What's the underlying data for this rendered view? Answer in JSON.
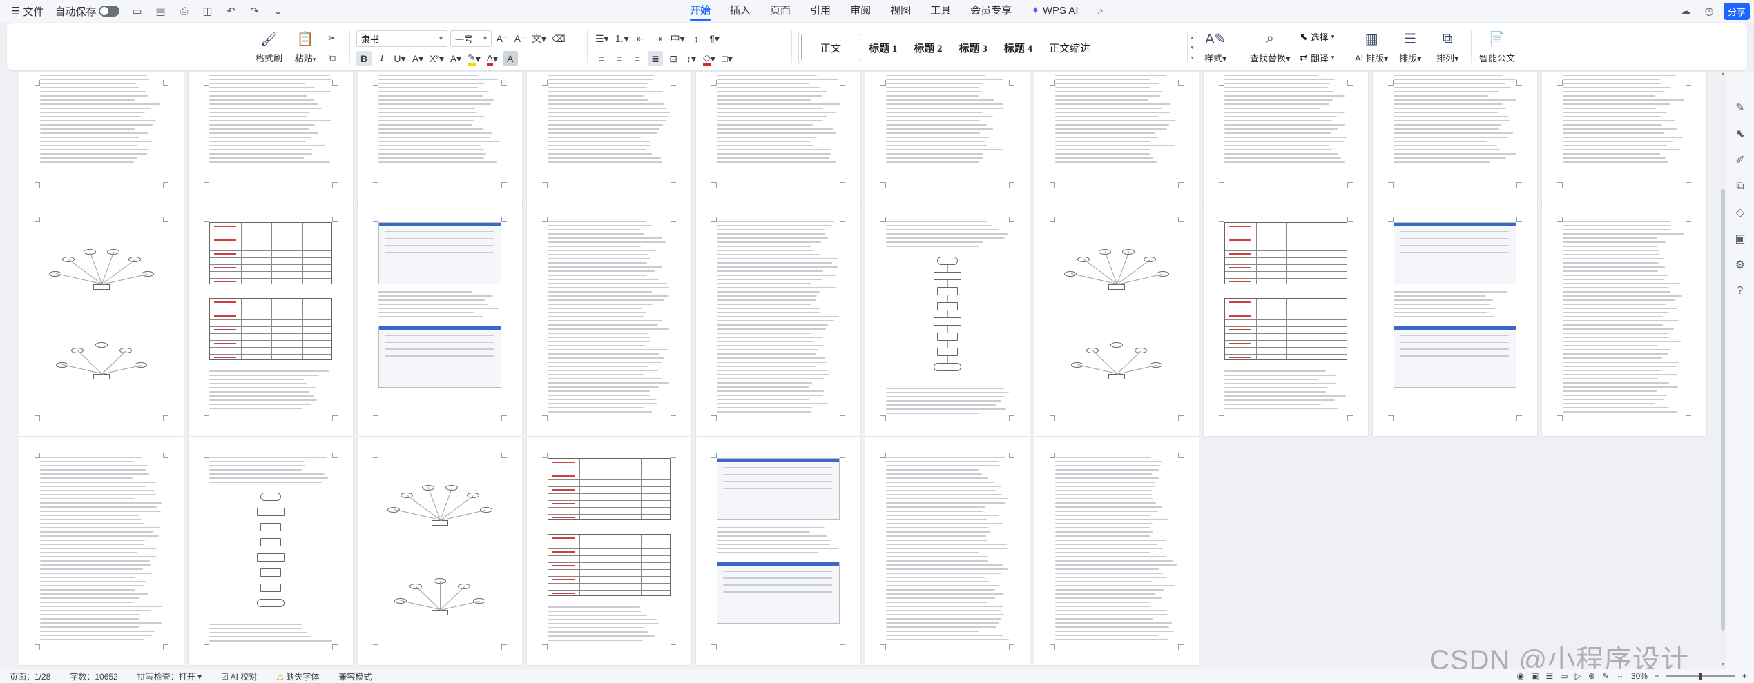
{
  "menubar": {
    "file_label": "文件",
    "autosave_label": "自动保存",
    "autosave_on": false,
    "tabs": [
      "开始",
      "插入",
      "页面",
      "引用",
      "审阅",
      "视图",
      "工具",
      "会员专享",
      "WPS AI"
    ],
    "active_tab": "开始",
    "share_label": "分享"
  },
  "ribbon": {
    "format_painter": "格式刷",
    "paste": "粘贴",
    "font_name": "隶书",
    "font_size": "一号",
    "style_gallery": [
      "正文",
      "标题 1",
      "标题 2",
      "标题 3",
      "标题 4",
      "正文缩进"
    ],
    "styles_label": "样式",
    "find_replace": "查找替换",
    "select": "选择",
    "translate": "翻译",
    "ai_layout": "AI 排版",
    "layout": "排版",
    "arrange": "排列",
    "smart_doc": "智能公文"
  },
  "colors": {
    "accent": "#1a66ff",
    "font_color_bar": "#d03030",
    "highlight_bar": "#f5d800",
    "shading_bar": "#d03030"
  },
  "statusbar": {
    "page": "页面：1/28",
    "word_count": "字数：10652",
    "spell_check": "拼写检查：打开",
    "proofread": "AI 校对",
    "missing_font": "缺失字体",
    "compat_mode": "兼容模式",
    "zoom": "30%"
  },
  "watermark": "CSDN @小程序设计"
}
